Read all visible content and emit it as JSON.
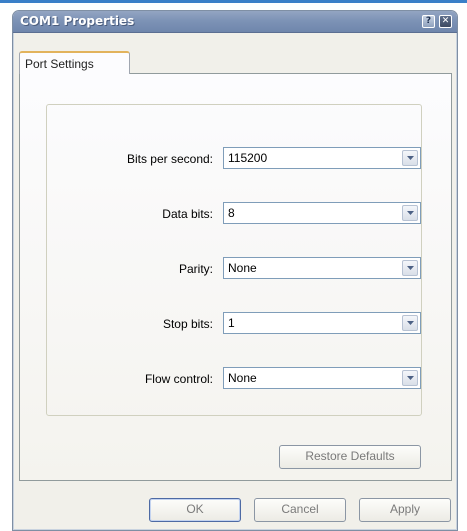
{
  "window": {
    "title": "COM1 Properties",
    "help_glyph": "?",
    "close_glyph": "✕"
  },
  "tabs": [
    {
      "label": "Port Settings",
      "selected": true
    }
  ],
  "settings": [
    {
      "label": "Bits per second:",
      "value": "115200"
    },
    {
      "label": "Data bits:",
      "value": "8"
    },
    {
      "label": "Parity:",
      "value": "None"
    },
    {
      "label": "Stop bits:",
      "value": "1"
    },
    {
      "label": "Flow control:",
      "value": "None"
    }
  ],
  "buttons": {
    "restore_defaults": "Restore Defaults",
    "ok": "OK",
    "cancel": "Cancel",
    "apply": "Apply"
  },
  "colors": {
    "titlebar": "#7d93b6",
    "tab_highlight": "#e2b35c",
    "combo_border": "#7f9db9"
  }
}
